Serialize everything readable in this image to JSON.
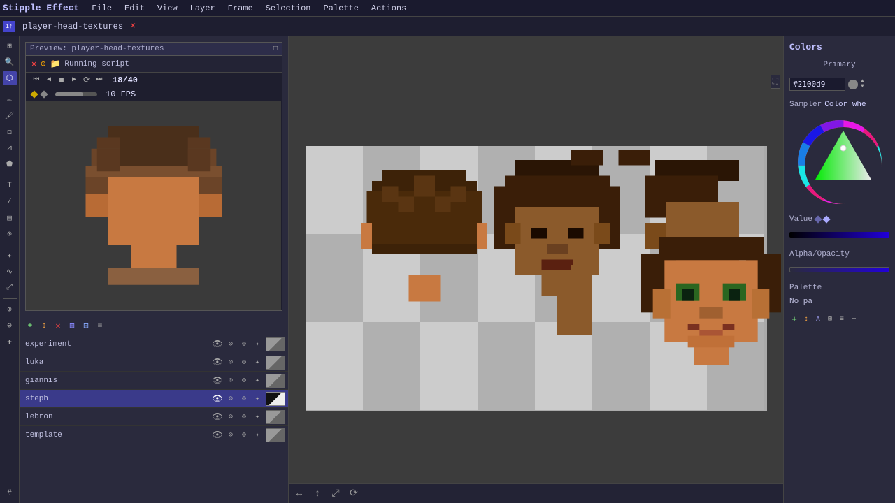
{
  "app": {
    "title": "Stipple Effect",
    "tab_name": "player-head-textures",
    "tab_close": "×"
  },
  "menubar": {
    "items": [
      "File",
      "Edit",
      "View",
      "Layer",
      "Frame",
      "Selection",
      "Palette",
      "Actions"
    ]
  },
  "preview": {
    "title": "Preview: player-head-textures",
    "maximize_icon": "□"
  },
  "script": {
    "status": "Running script",
    "frame_current": "18",
    "frame_total": "40",
    "frame_display": "18/40",
    "fps": "10 FPS"
  },
  "colors": {
    "section_title": "Colors",
    "primary_label": "Primary",
    "hex_value": "#2100d9",
    "sampler_label": "Sampler",
    "sampler_value": "Color whe",
    "value_label": "Value",
    "alpha_label": "Alpha/Opacity",
    "palette_label": "Palette",
    "palette_value": "No pa"
  },
  "layers": {
    "header_icons": [
      "+",
      "↕",
      "✕",
      "⊞",
      "⊡",
      "≡"
    ],
    "items": [
      {
        "name": "experiment",
        "active": false,
        "preview_type": "gray"
      },
      {
        "name": "luka",
        "active": false,
        "preview_type": "gray"
      },
      {
        "name": "giannis",
        "active": false,
        "preview_type": "gray"
      },
      {
        "name": "steph",
        "active": true,
        "preview_type": "black-white"
      },
      {
        "name": "lebron",
        "active": false,
        "preview_type": "gray"
      },
      {
        "name": "template",
        "active": false,
        "preview_type": "gray"
      }
    ]
  },
  "tools": [
    "⊞",
    "↕",
    "✕",
    "⊙",
    "✎",
    "◻",
    "⊿",
    "⬟",
    "T",
    "∿",
    "⌖",
    "⬡",
    "⊕",
    "⊖"
  ],
  "canvas": {
    "expand_icon": "⛶",
    "bottom_icons": [
      "↔",
      "↕",
      "⤢",
      "⊙"
    ]
  }
}
